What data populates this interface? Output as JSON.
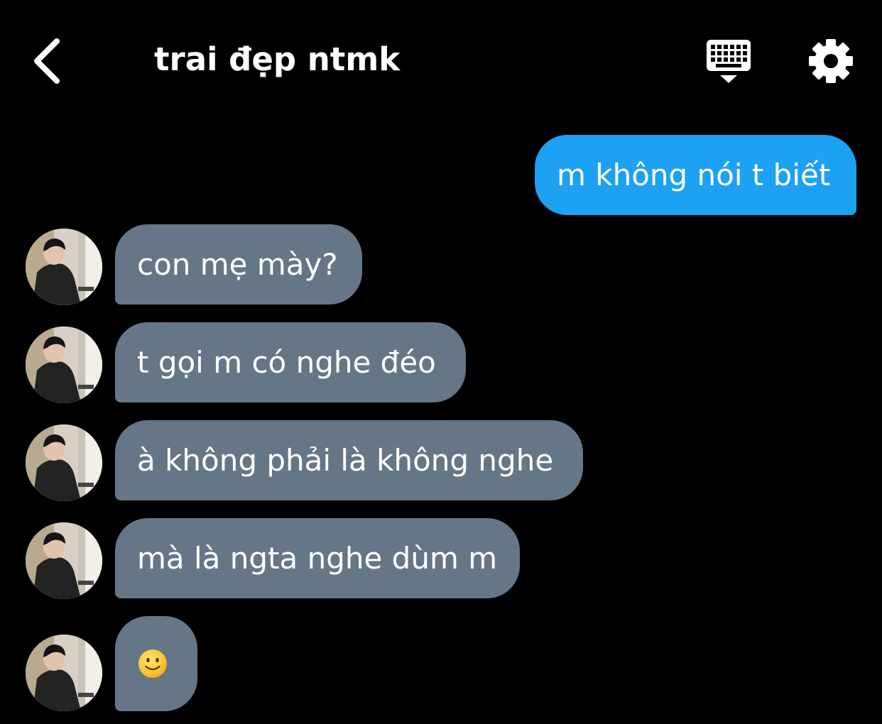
{
  "header": {
    "title": "trai đẹp ntmk",
    "back_icon": "chevron-left-icon",
    "keyboard_icon": "keyboard-icon",
    "settings_icon": "gear-icon"
  },
  "colors": {
    "background": "#000000",
    "sent_bubble": "#1da1f2",
    "received_bubble": "#657786",
    "text": "#ffffff"
  },
  "messages": [
    {
      "direction": "sent",
      "text": "m không nói t biết"
    },
    {
      "direction": "received",
      "text": "con mẹ mày?"
    },
    {
      "direction": "received",
      "text": "t gọi m có nghe đéo"
    },
    {
      "direction": "received",
      "text": "à không phải là không nghe"
    },
    {
      "direction": "received",
      "text": "mà là ngta nghe dùm m"
    },
    {
      "direction": "received",
      "text": "",
      "emoji": "slightly-smiling-face-icon"
    }
  ]
}
